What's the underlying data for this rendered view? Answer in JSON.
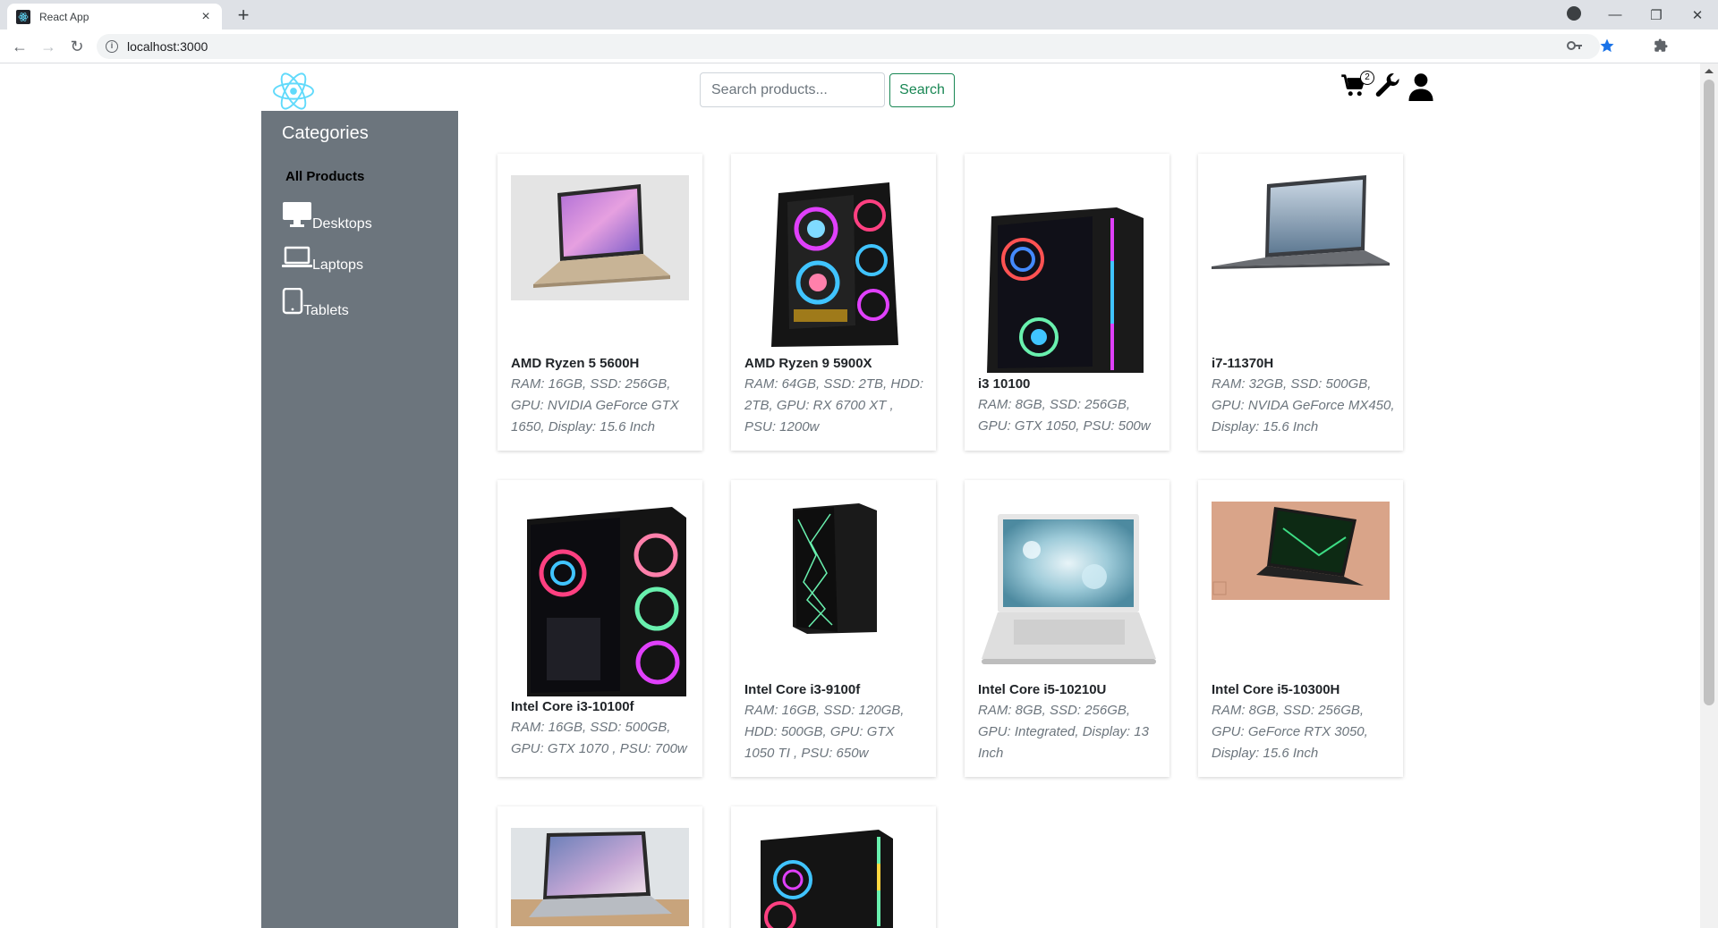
{
  "browser": {
    "tab_title": "React App",
    "tab_close": "×",
    "new_tab": "+",
    "url": "localhost:3000",
    "window_minimize": "—",
    "window_restore": "❐",
    "window_close": "✕"
  },
  "header": {
    "search_placeholder": "Search products...",
    "search_button": "Search",
    "cart_count": "2"
  },
  "sidebar": {
    "title": "Categories",
    "items": [
      {
        "label": "All Products",
        "icon": "none"
      },
      {
        "label": "Desktops",
        "icon": "desktop-icon"
      },
      {
        "label": "Laptops",
        "icon": "laptop-icon"
      },
      {
        "label": "Tablets",
        "icon": "tablet-icon"
      }
    ]
  },
  "products": [
    {
      "name": "AMD Ryzen 5 5600H",
      "desc": "RAM: 16GB, SSD: 256GB, GPU: NVIDIA GeForce GTX 1650, Display: 15.6 Inch",
      "image": "laptop-image"
    },
    {
      "name": "AMD Ryzen 9 5900X",
      "desc": "RAM: 64GB, SSD: 2TB, HDD: 2TB, GPU: RX 6700 XT , PSU: 1200w",
      "image": "desktop-image"
    },
    {
      "name": "i3 10100",
      "desc": "RAM: 8GB, SSD: 256GB, GPU: GTX 1050, PSU: 500w",
      "image": "desktop-image"
    },
    {
      "name": "i7-11370H",
      "desc": "RAM: 32GB, SSD: 500GB, GPU: NVIDA GeForce MX450, Display: 15.6 Inch",
      "image": "laptop-image"
    },
    {
      "name": "Intel Core i3-10100f",
      "desc": "RAM: 16GB, SSD: 500GB, GPU: GTX 1070 , PSU: 700w",
      "image": "desktop-image"
    },
    {
      "name": "Intel Core i3-9100f",
      "desc": "RAM: 16GB, SSD: 120GB, HDD: 500GB, GPU: GTX 1050 TI , PSU: 650w",
      "image": "desktop-image"
    },
    {
      "name": "Intel Core i5-10210U",
      "desc": "RAM: 8GB, SSD: 256GB, GPU: Integrated, Display: 13 Inch",
      "image": "laptop-image"
    },
    {
      "name": "Intel Core i5-10300H",
      "desc": "RAM: 8GB, SSD: 256GB, GPU: GeForce RTX 3050, Display: 15.6 Inch",
      "image": "laptop-image"
    },
    {
      "name": "",
      "desc": "",
      "image": "laptop-image"
    },
    {
      "name": "",
      "desc": "",
      "image": "desktop-image"
    }
  ],
  "colors": {
    "sidebar_bg": "#6c757d",
    "search_button": "#198754",
    "react_blue": "#61dafb"
  }
}
